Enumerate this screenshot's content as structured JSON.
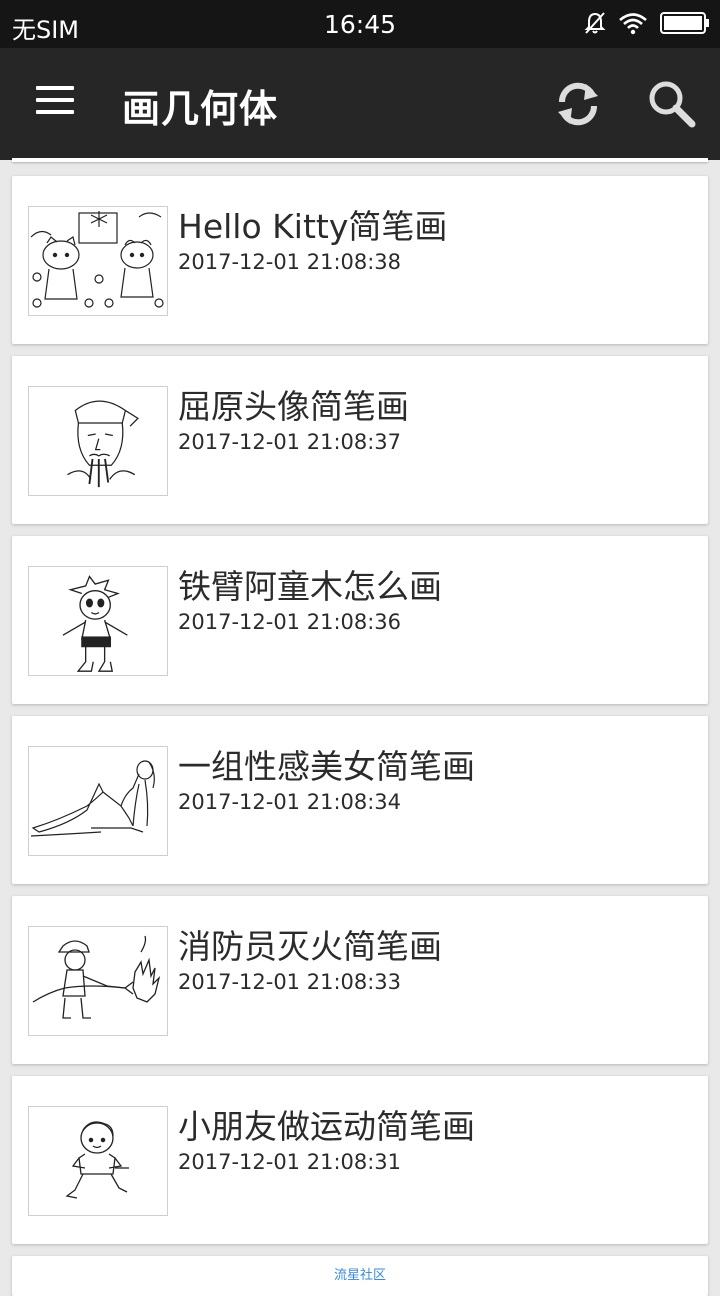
{
  "status_bar": {
    "carrier": "无SIM",
    "time": "16:45"
  },
  "app_bar": {
    "title": "画几何体"
  },
  "items": [
    {
      "title": "Hello Kitty简笔画",
      "date": "2017-12-01 21:08:38"
    },
    {
      "title": "屈原头像简笔画",
      "date": "2017-12-01 21:08:37"
    },
    {
      "title": "铁臂阿童木怎么画",
      "date": "2017-12-01 21:08:36"
    },
    {
      "title": "一组性感美女简笔画",
      "date": "2017-12-01 21:08:34"
    },
    {
      "title": "消防员灭火简笔画",
      "date": "2017-12-01 21:08:33"
    },
    {
      "title": "小朋友做运动简笔画",
      "date": "2017-12-01 21:08:31"
    }
  ],
  "footer": {
    "text": "流星社区"
  }
}
